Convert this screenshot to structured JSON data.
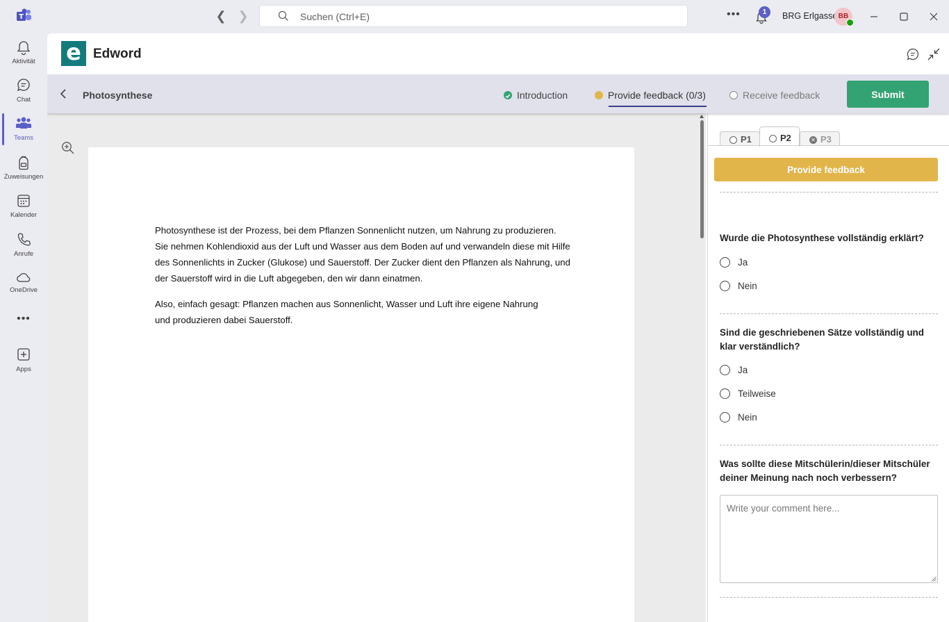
{
  "titlebar": {
    "search_placeholder": "Suchen (Ctrl+E)",
    "notification_count": "1",
    "org_name": "BRG Erlgasse",
    "avatar_initials": "BB"
  },
  "rail": {
    "items": [
      {
        "label": "Aktivität",
        "icon": "bell-icon"
      },
      {
        "label": "Chat",
        "icon": "chat-icon"
      },
      {
        "label": "Teams",
        "icon": "teams-icon"
      },
      {
        "label": "Zuweisungen",
        "icon": "backpack-icon"
      },
      {
        "label": "Kalender",
        "icon": "calendar-icon"
      },
      {
        "label": "Anrufe",
        "icon": "phone-icon"
      },
      {
        "label": "OneDrive",
        "icon": "cloud-icon"
      },
      {
        "label": "Apps",
        "icon": "plus-box-icon"
      }
    ],
    "active": "Teams",
    "accent": "#5b5fc7"
  },
  "app": {
    "logo_letter": "e",
    "title": "Edword"
  },
  "stepbar": {
    "document_title": "Photosynthese",
    "steps": [
      {
        "label": "Introduction",
        "color": "#34a373"
      },
      {
        "label": "Provide feedback (0/3)",
        "color": "#e2b54b"
      },
      {
        "label": "Receive feedback",
        "color": "#ffffff"
      }
    ],
    "submit_label": "Submit"
  },
  "document": {
    "paragraphs": [
      "Photosynthese ist der Prozess, bei dem Pflanzen Sonnenlicht nutzen, um Nahrung zu produzieren. Sie nehmen Kohlendioxid aus der Luft und Wasser aus dem Boden auf und verwandeln diese mit Hilfe des Sonnenlichts in Zucker (Glukose) und Sauerstoff. Der Zucker dient den Pflanzen als Nahrung, und der Sauerstoff wird in die Luft abgegeben, den wir dann einatmen.",
      "Also, einfach gesagt: Pflanzen machen aus Sonnenlicht, Wasser und Luft ihre eigene Nahrung und produzieren dabei Sauerstoff."
    ]
  },
  "panel": {
    "tabs": [
      {
        "label": "P1",
        "state": "unselected"
      },
      {
        "label": "P2",
        "state": "active"
      },
      {
        "label": "P3",
        "state": "disabled"
      }
    ],
    "provide_feedback_label": "Provide feedback",
    "questions": [
      {
        "text": "Wurde die Photosynthese vollständig erklärt?",
        "options": [
          "Ja",
          "Nein"
        ]
      },
      {
        "text": "Sind die geschriebenen Sätze vollständig und klar verständlich?",
        "options": [
          "Ja",
          "Teilweise",
          "Nein"
        ]
      },
      {
        "text": "Was sollte diese Mitschülerin/dieser Mitschüler deiner Meinung nach noch verbessern?"
      }
    ],
    "comment_placeholder": "Write your comment here..."
  }
}
